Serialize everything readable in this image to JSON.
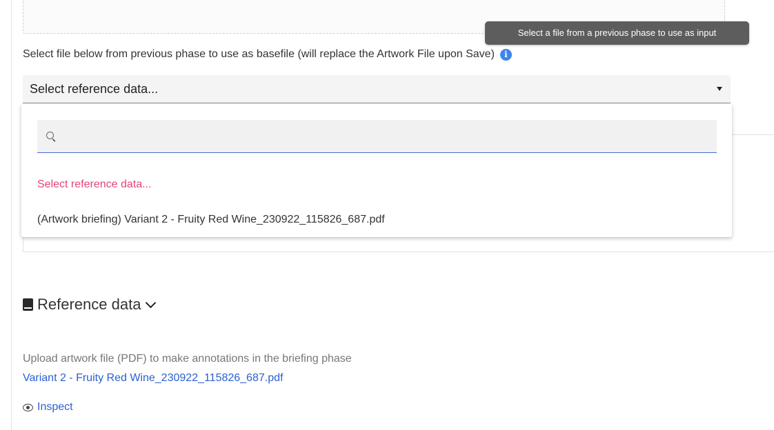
{
  "tooltip": {
    "text": "Select a file from a previous phase to use as input"
  },
  "basefile": {
    "helper_text": "Select file below from previous phase to use as basefile (will replace the Artwork File upon Save)",
    "select_value": "Select reference data..."
  },
  "dropdown": {
    "search_placeholder": "",
    "options": [
      {
        "label": "Select reference data...",
        "placeholder": true
      },
      {
        "label": "(Artwork briefing) Variant 2 - Fruity Red Wine_230922_115826_687.pdf",
        "placeholder": false
      }
    ]
  },
  "reference_section": {
    "title": "Reference data",
    "description": "Upload artwork file (PDF) to make annotations in the briefing phase",
    "file_link": "Variant 2 - Fruity Red Wine_230922_115826_687.pdf",
    "inspect_label": "Inspect"
  },
  "icons": [
    "info-icon",
    "search-icon",
    "book-icon",
    "chevron-down-icon",
    "eye-icon",
    "caret-down-icon"
  ],
  "colors": {
    "accent": "#3f83f0",
    "link": "#2a5fd2",
    "placeholder_option": "#e0457b",
    "tooltip_bg": "#5d5d5d"
  }
}
